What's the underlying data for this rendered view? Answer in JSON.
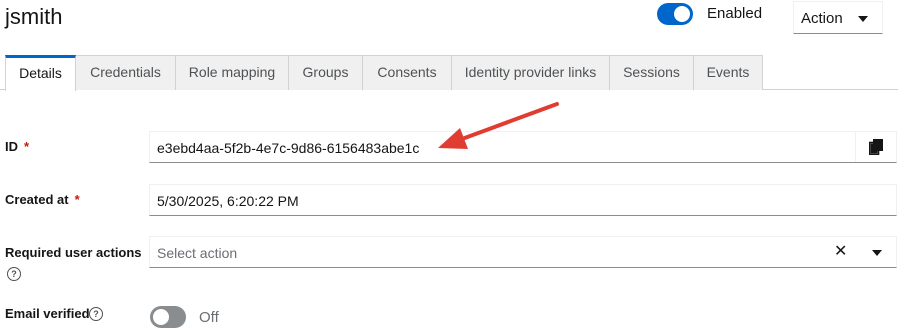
{
  "header": {
    "username": "jsmith",
    "enabled_label": "Enabled",
    "action_label": "Action"
  },
  "tabs": [
    {
      "label": "Details",
      "active": true
    },
    {
      "label": "Credentials"
    },
    {
      "label": "Role mapping"
    },
    {
      "label": "Groups"
    },
    {
      "label": "Consents"
    },
    {
      "label": "Identity provider links"
    },
    {
      "label": "Sessions"
    },
    {
      "label": "Events"
    }
  ],
  "form": {
    "id": {
      "label": "ID",
      "required_mark": "*",
      "value": "e3ebd4aa-5f2b-4e7c-9d86-6156483abe1c"
    },
    "created_at": {
      "label": "Created at",
      "required_mark": "*",
      "value": "5/30/2025, 6:20:22 PM"
    },
    "required_actions": {
      "label": "Required user actions",
      "placeholder": "Select action"
    },
    "email_verified": {
      "label": "Email verified",
      "state_label": "Off"
    }
  },
  "colors": {
    "accent": "#0066cc",
    "required": "#c9190b",
    "annotation_arrow": "#e03c31"
  },
  "icons": [
    "copy-icon",
    "clear-icon",
    "chevron-down-icon",
    "help-icon",
    "annotation-arrow"
  ]
}
